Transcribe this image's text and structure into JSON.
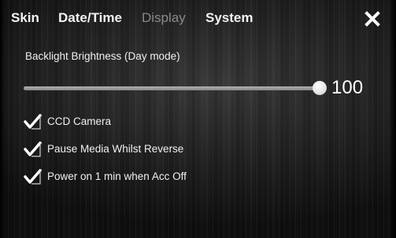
{
  "tabs": [
    {
      "label": "Skin",
      "active": false
    },
    {
      "label": "Date/Time",
      "active": false
    },
    {
      "label": "Display",
      "active": false
    },
    {
      "label": "System",
      "active": true
    }
  ],
  "close_icon": "close-x-icon",
  "brightness": {
    "label": "Backlight Brightness (Day mode)",
    "value": "100",
    "level": 1.0
  },
  "options": [
    {
      "label": "CCD Camera",
      "checked": true
    },
    {
      "label": "Pause Media Whilst Reverse",
      "checked": true
    },
    {
      "label": "Power on 1 min when Acc Off",
      "checked": true
    }
  ],
  "check_icon": "checkmark-icon",
  "colors": {
    "background": "#1e1e1e",
    "text": "#f0f0f0",
    "dim_tab": "#8a8a8a",
    "track": "#7a7a7a",
    "thumb": "#ffffff"
  }
}
